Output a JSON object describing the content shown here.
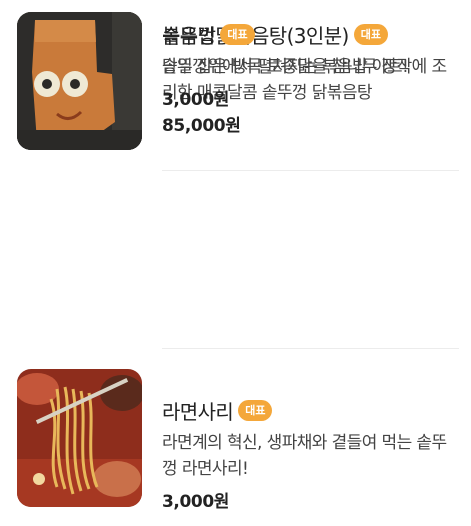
{
  "menu": [
    {
      "name": "솥뚜껑닭볶음탕(3인분)",
      "badge": "대표",
      "description": "당일 잡은 방목 토종닭을 참나무 장작에 조리한 매콤달콤 솥뚜껑 닭볶음탕",
      "price": "85,000원",
      "image_icon": "spicy-chicken-stew-photo"
    },
    {
      "name": "라면사리",
      "badge": "대표",
      "description": "라면계의 혁신, 생파채와 곁들여 먹는 솥뚜껑 라면사리!",
      "price": "3,000원",
      "image_icon": "ramen-noodle-photo"
    },
    {
      "name": "볶음밥",
      "badge": "대표",
      "description": "솥뚜껑위에서 펼쳐지는 볶음밥 아트!",
      "price": "3,000원",
      "image_icon": "fried-rice-art-photo"
    }
  ],
  "colors": {
    "badge": "#f4a73a",
    "title": "#222222",
    "description": "#444444",
    "divider": "#ececec"
  }
}
